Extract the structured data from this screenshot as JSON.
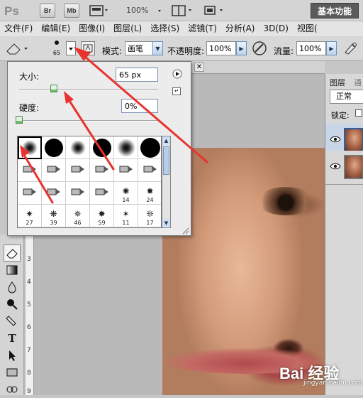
{
  "app": {
    "logo": "Ps",
    "bridge_label": "Br",
    "minibridge_label": "Mb",
    "zoom": "100%",
    "workspace": "基本功能"
  },
  "menu": [
    "文件(F)",
    "编辑(E)",
    "图像(I)",
    "图层(L)",
    "选择(S)",
    "滤镜(T)",
    "分析(A)",
    "3D(D)",
    "视图("
  ],
  "options": {
    "brush_size": "65",
    "mode_label": "模式:",
    "mode_value": "画笔",
    "opacity_label": "不透明度:",
    "opacity_value": "100%",
    "flow_label": "流量:",
    "flow_value": "100%"
  },
  "brush_picker": {
    "size_label": "大小:",
    "size_value": "65 px",
    "size_fraction": 0.25,
    "hardness_label": "硬度:",
    "hardness_value": "0%",
    "hardness_fraction": 0,
    "presets": [
      {
        "kind": "soft",
        "d": 22,
        "label": ""
      },
      {
        "kind": "hard",
        "d": 26,
        "label": ""
      },
      {
        "kind": "soft",
        "d": 22,
        "label": ""
      },
      {
        "kind": "hard",
        "d": 26,
        "label": ""
      },
      {
        "kind": "soft",
        "d": 26,
        "label": ""
      },
      {
        "kind": "hard",
        "d": 28,
        "label": ""
      },
      {
        "kind": "tool",
        "label": ""
      },
      {
        "kind": "tool",
        "label": ""
      },
      {
        "kind": "tool",
        "label": ""
      },
      {
        "kind": "tool",
        "label": ""
      },
      {
        "kind": "tool",
        "label": ""
      },
      {
        "kind": "tool",
        "label": ""
      },
      {
        "kind": "tool",
        "label": ""
      },
      {
        "kind": "tool",
        "label": ""
      },
      {
        "kind": "tool",
        "label": ""
      },
      {
        "kind": "tool",
        "label": ""
      },
      {
        "kind": "splat",
        "label": "14"
      },
      {
        "kind": "splat",
        "label": "24"
      },
      {
        "kind": "splat",
        "label": "27"
      },
      {
        "kind": "splat",
        "label": "39"
      },
      {
        "kind": "splat",
        "label": "46"
      },
      {
        "kind": "splat",
        "label": "59"
      },
      {
        "kind": "splat",
        "label": "11"
      },
      {
        "kind": "splat",
        "label": "17"
      }
    ]
  },
  "ruler": [
    "3",
    "4",
    "5",
    "6",
    "7",
    "8",
    "9"
  ],
  "panel": {
    "tab": "图层",
    "tab2": "通",
    "blend": "正常",
    "lock_label": "锁定:"
  },
  "watermark": {
    "text": "Bai 经验",
    "url": "jingyan.baidu.com"
  },
  "colors": {
    "arrow": "#e8332e",
    "accent": "#2f5d9a",
    "workspace_bg": "#5b5b5b"
  }
}
